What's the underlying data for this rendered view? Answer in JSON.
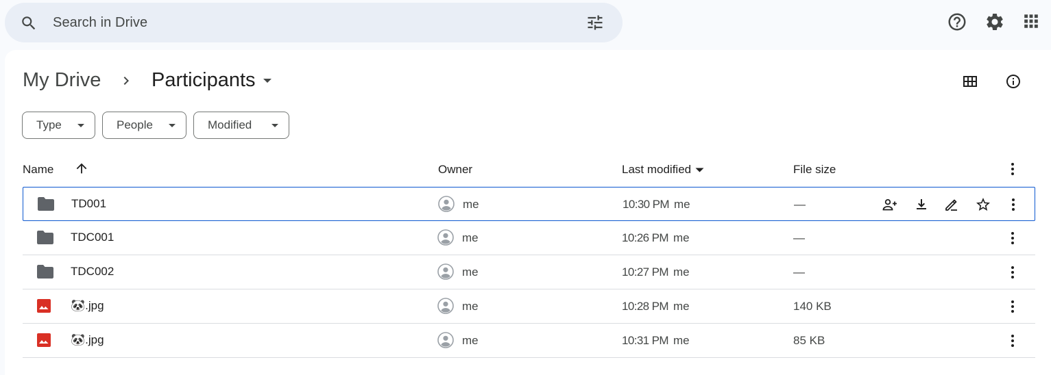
{
  "search": {
    "placeholder": "Search in Drive"
  },
  "icons": {
    "search": "search-icon",
    "filter_options": "tune-icon",
    "help": "help-icon",
    "settings": "gear-icon",
    "apps": "apps-grid-icon",
    "grid_view": "grid-view-icon",
    "details": "info-icon"
  },
  "breadcrumb": {
    "root": "My Drive",
    "current": "Participants"
  },
  "filters": [
    {
      "label": "Type"
    },
    {
      "label": "People"
    },
    {
      "label": "Modified"
    }
  ],
  "table": {
    "columns": {
      "name": "Name",
      "owner": "Owner",
      "last_modified": "Last modified",
      "file_size": "File size"
    },
    "sort": {
      "column": "Last modified",
      "direction": "descending",
      "name_arrow": "up"
    },
    "rows": [
      {
        "name": "TD001",
        "type": "folder",
        "owner": "me",
        "modified_time": "10:30 PM",
        "modified_by": "me",
        "size": "—",
        "selected": true
      },
      {
        "name": "TDC001",
        "type": "folder",
        "owner": "me",
        "modified_time": "10:26 PM",
        "modified_by": "me",
        "size": "—",
        "selected": false
      },
      {
        "name": "TDC002",
        "type": "folder",
        "owner": "me",
        "modified_time": "10:27 PM",
        "modified_by": "me",
        "size": "—",
        "selected": false
      },
      {
        "name": "🐼.jpg",
        "type": "image",
        "owner": "me",
        "modified_time": "10:28 PM",
        "modified_by": "me",
        "size": "140 KB",
        "selected": false
      },
      {
        "name": "🐼.jpg",
        "type": "image",
        "owner": "me",
        "modified_time": "10:31 PM",
        "modified_by": "me",
        "size": "85 KB",
        "selected": false
      }
    ]
  },
  "row_actions": [
    "share",
    "download",
    "rename",
    "add-to-starred"
  ],
  "colors": {
    "page_bg": "#f8fafd",
    "search_bg": "#e9eef6",
    "selection_border": "#0b57d0",
    "folder": "#5f6368",
    "image_file": "#d93025"
  }
}
